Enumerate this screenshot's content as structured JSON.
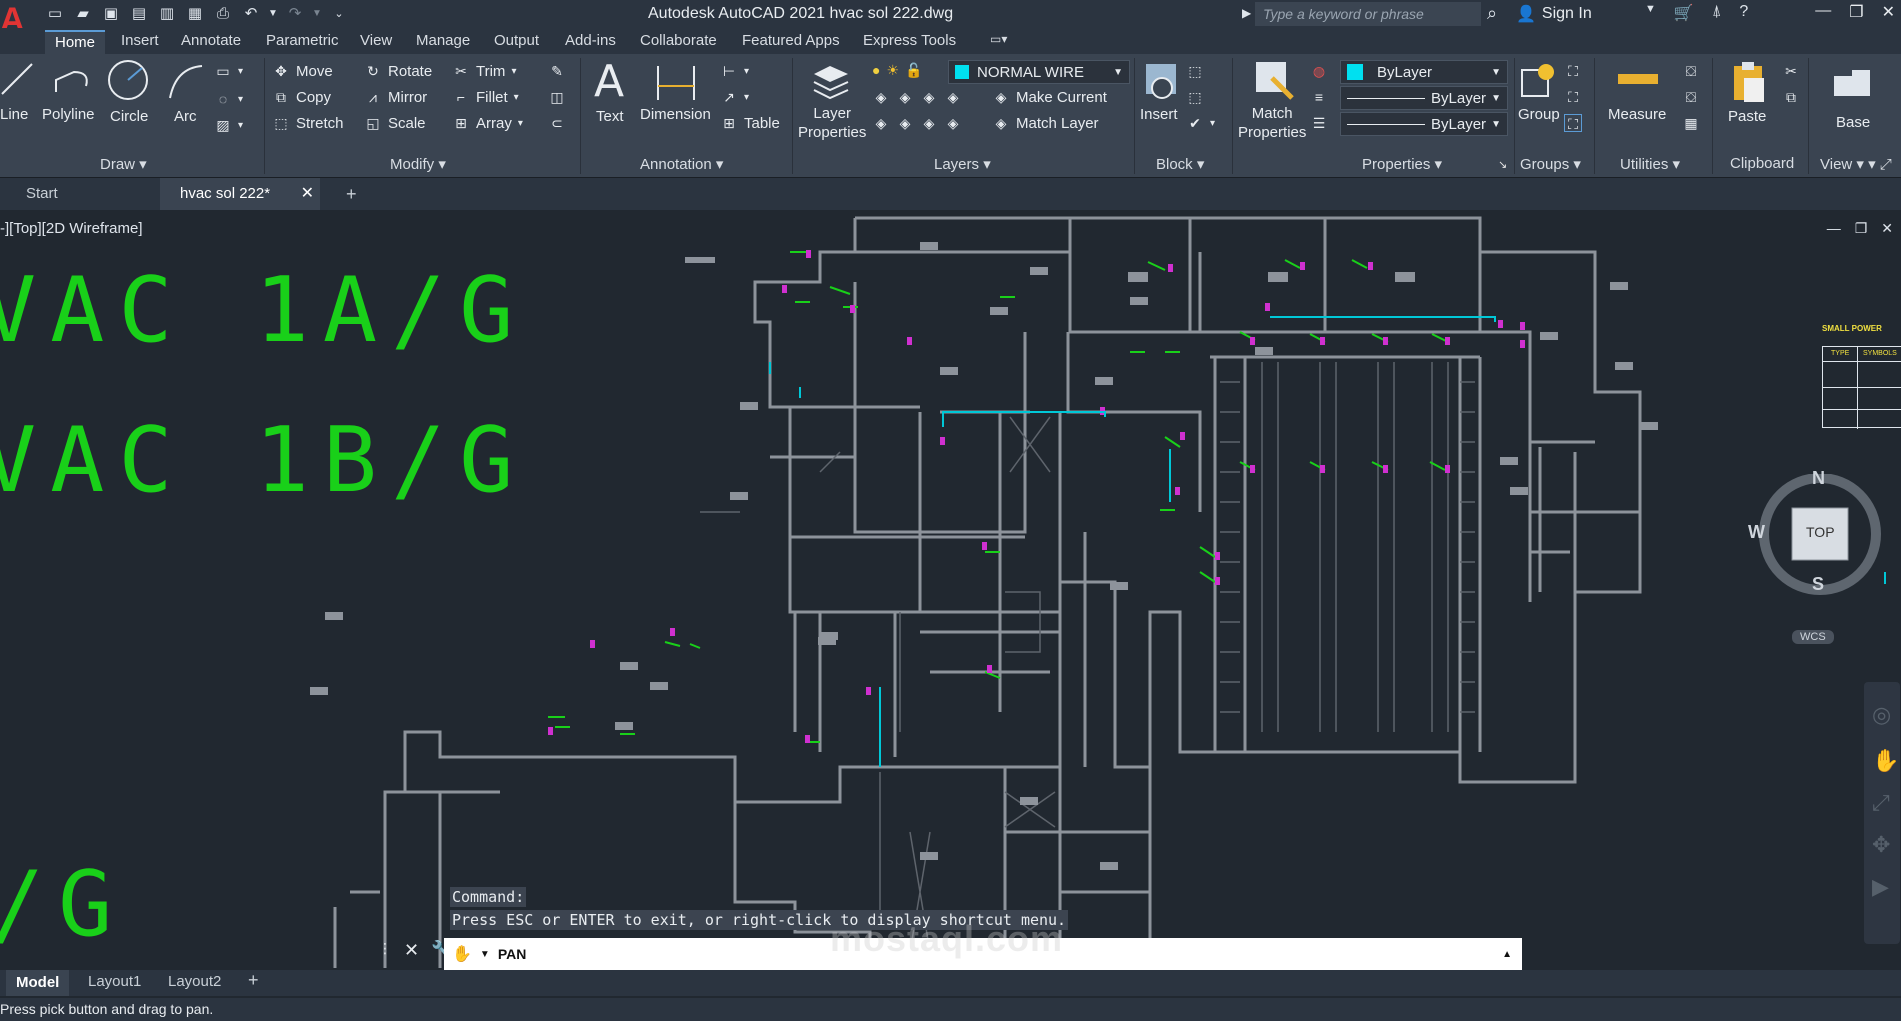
{
  "app": {
    "logo": "A",
    "title": "Autodesk AutoCAD 2021    hvac sol 222.dwg",
    "search_placeholder": "Type a keyword or phrase",
    "sign_in": "Sign In"
  },
  "ribbon_tabs": [
    "Home",
    "Insert",
    "Annotate",
    "Parametric",
    "View",
    "Manage",
    "Output",
    "Add-ins",
    "Collaborate",
    "Featured Apps",
    "Express Tools"
  ],
  "draw": {
    "title": "Draw",
    "line": "Line",
    "polyline": "Polyline",
    "circle": "Circle",
    "arc": "Arc"
  },
  "modify": {
    "title": "Modify",
    "move": "Move",
    "rotate": "Rotate",
    "trim": "Trim",
    "copy": "Copy",
    "mirror": "Mirror",
    "fillet": "Fillet",
    "stretch": "Stretch",
    "scale": "Scale",
    "array": "Array"
  },
  "annotation": {
    "title": "Annotation",
    "text": "Text",
    "dimension": "Dimension",
    "table": "Table"
  },
  "layers": {
    "title": "Layers",
    "layer_properties_line1": "Layer",
    "layer_properties_line2": "Properties",
    "current_layer": "NORMAL WIRE",
    "make_current": "Make Current",
    "match_layer": "Match Layer"
  },
  "block": {
    "title": "Block",
    "insert": "Insert"
  },
  "properties": {
    "title": "Properties",
    "match_line1": "Match",
    "match_line2": "Properties",
    "color": "ByLayer",
    "linetype": "ByLayer",
    "lineweight": "ByLayer"
  },
  "groups": {
    "title": "Groups",
    "group": "Group"
  },
  "utilities": {
    "title": "Utilities",
    "measure": "Measure"
  },
  "clipboard": {
    "title": "Clipboard",
    "paste": "Paste"
  },
  "view": {
    "title": "View",
    "base": "Base"
  },
  "doc_tabs": {
    "start": "Start",
    "active": "hvac sol 222*"
  },
  "viewport": {
    "label": "-][Top][2D Wireframe]",
    "text_1": "VAC 1A/G",
    "text_2": "VAC 1B/G",
    "text_3": "/G"
  },
  "viewcube": {
    "north": "N",
    "south": "S",
    "west": "W",
    "face": "TOP",
    "wcs": "WCS",
    "legend_title": "SMALL POWER",
    "legend_col1": "TYPE",
    "legend_col2": "SYMBOLS"
  },
  "command": {
    "history_1": "Command:",
    "history_2": "Press ESC or ENTER to exit, or right-click to display shortcut menu.",
    "current": "PAN"
  },
  "layout_tabs": [
    "Model",
    "Layout1",
    "Layout2"
  ],
  "status_text": "Press pick button and drag to pan.",
  "watermark": "mostaql.com",
  "colors": {
    "accent": "#5b9bd5",
    "drawing_green": "#19d019",
    "drawing_cyan": "#00c8d7",
    "drawing_magenta": "#d030d0",
    "walls": "#8d939b"
  }
}
